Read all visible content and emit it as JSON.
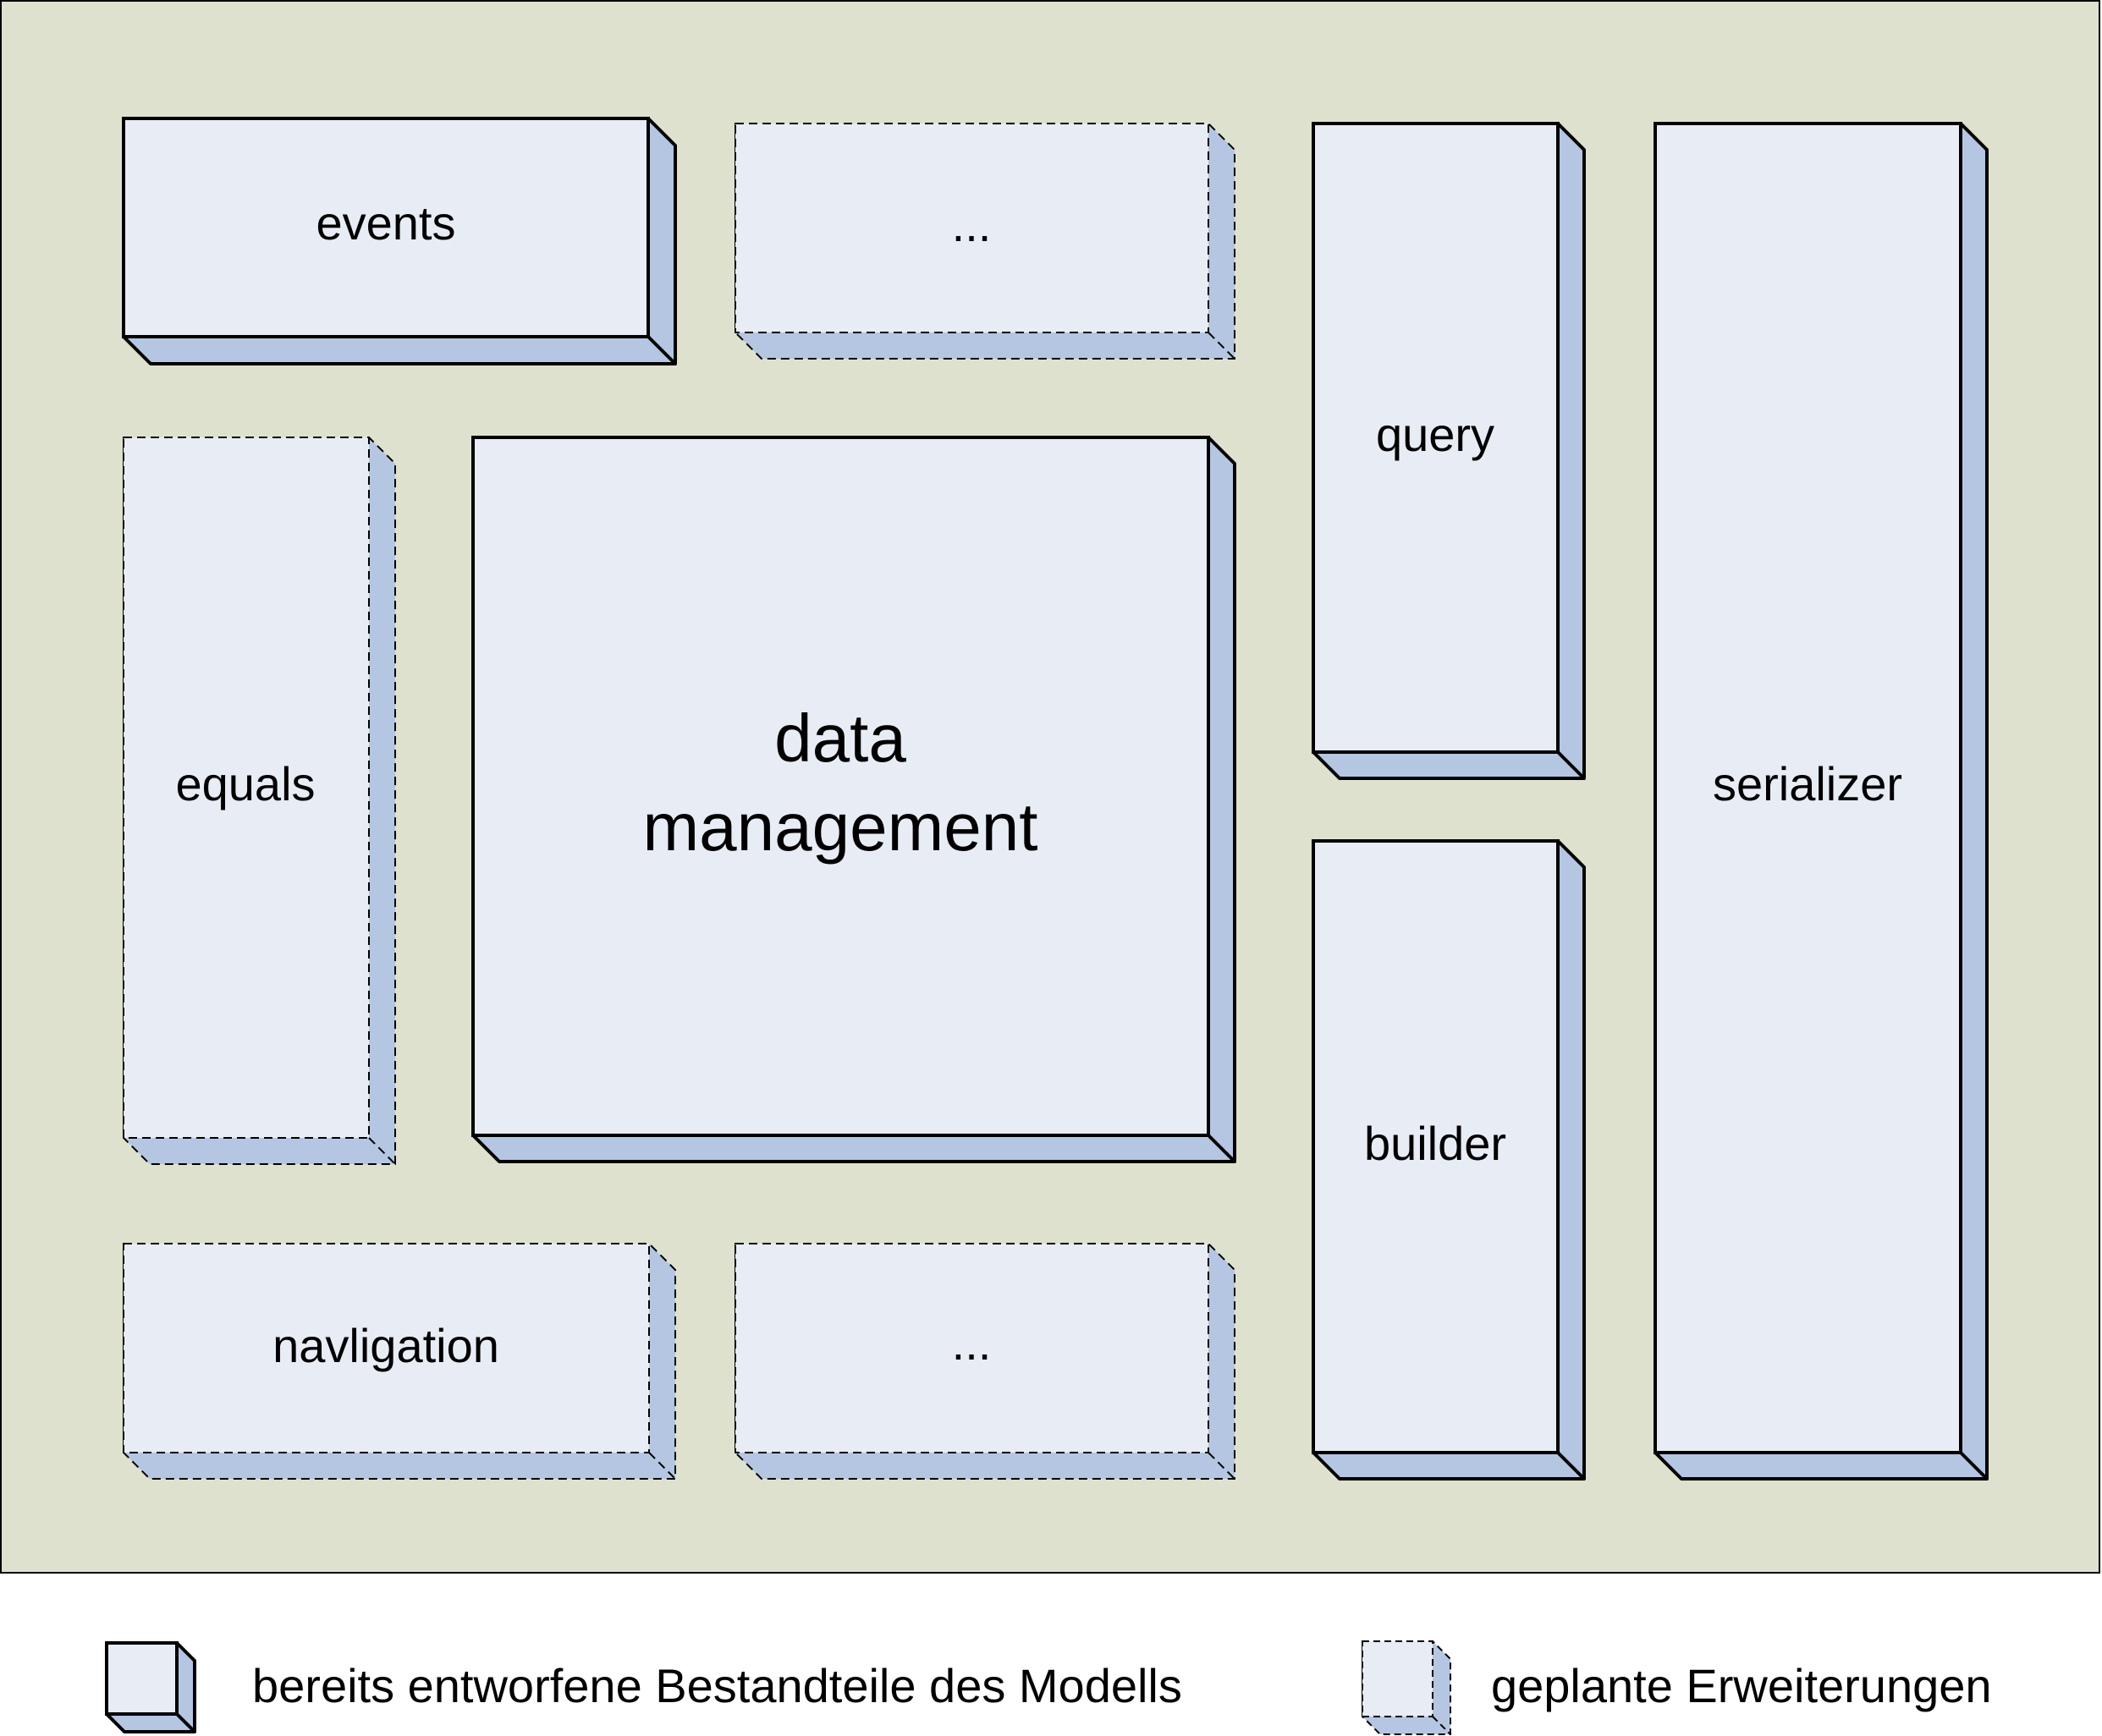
{
  "colors": {
    "frame_fill": "#DFE1CF",
    "box_face": "#E8ECF5",
    "box_side": "#B4C6E1",
    "stroke": "#000000",
    "page": "#FFFFFF"
  },
  "diagram": {
    "modules": [
      {
        "id": "events",
        "label": "events",
        "status": "designed"
      },
      {
        "id": "top-ellipsis",
        "label": "...",
        "status": "planned"
      },
      {
        "id": "query",
        "label": "query",
        "status": "designed"
      },
      {
        "id": "serializer",
        "label": "serializer",
        "status": "designed"
      },
      {
        "id": "equals",
        "label": "equals",
        "status": "planned"
      },
      {
        "id": "data-management",
        "label_line1": "data",
        "label_line2": "management",
        "status": "designed"
      },
      {
        "id": "builder",
        "label": "builder",
        "status": "designed"
      },
      {
        "id": "navigation",
        "label": "navligation",
        "status": "planned"
      },
      {
        "id": "bottom-ellipsis",
        "label": "...",
        "status": "planned"
      }
    ]
  },
  "legend": {
    "designed_label": "bereits entworfene Bestandteile des Modells",
    "planned_label": "geplante Erweiterungen"
  }
}
